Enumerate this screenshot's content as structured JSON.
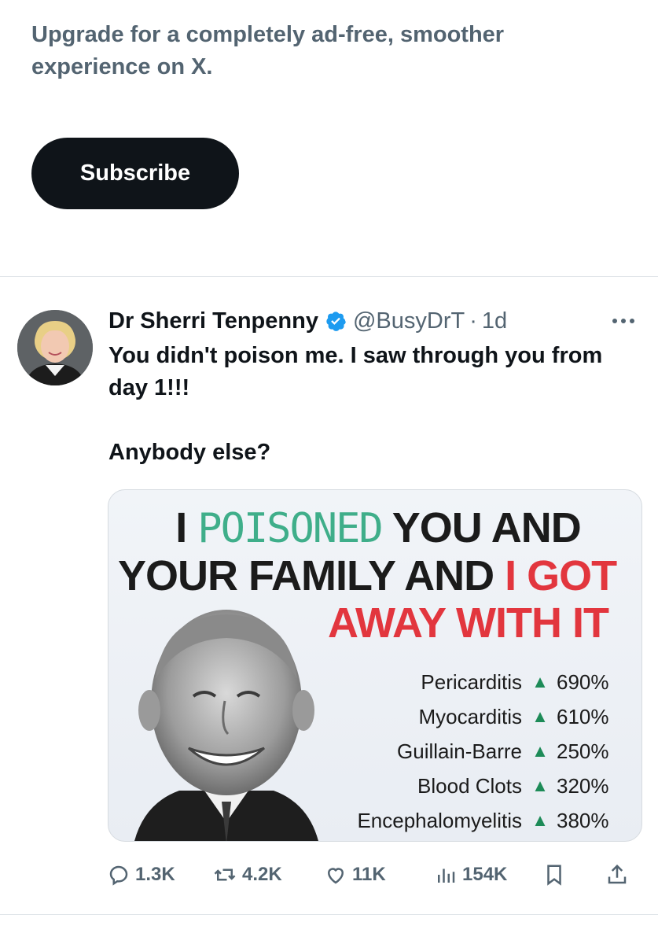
{
  "promo": {
    "text": "Upgrade for a completely ad-free, smoother experience on X.",
    "subscribe_label": "Subscribe"
  },
  "tweet": {
    "author": {
      "display_name": "Dr Sherri Tenpenny",
      "handle": "@BusyDrT",
      "separator": "·",
      "time": "1d",
      "verified": true
    },
    "text_lines": [
      "You didn't poison me. I saw through you from day 1!!!",
      "Anybody else?"
    ],
    "media": {
      "headline": {
        "i": "I",
        "poisoned": "POISONED",
        "you_and": "YOU AND",
        "your_family_and": "YOUR FAMILY AND",
        "i_got": "I GOT",
        "away_with_it": "AWAY WITH IT"
      },
      "stats": [
        {
          "name": "Pericarditis",
          "value": "690%"
        },
        {
          "name": "Myocarditis",
          "value": "610%"
        },
        {
          "name": "Guillain-Barre",
          "value": "250%"
        },
        {
          "name": "Blood Clots",
          "value": "320%"
        },
        {
          "name": "Encephalomyelitis",
          "value": "380%"
        }
      ],
      "colors": {
        "green": "#3fae8a",
        "red": "#e2363e",
        "arrow": "#1d8b58"
      }
    },
    "actions": {
      "replies": "1.3K",
      "reposts": "4.2K",
      "likes": "11K",
      "views": "154K"
    }
  },
  "icons": {
    "verified": "verified-badge-icon",
    "more": "more-horizontal-icon",
    "reply": "reply-icon",
    "repost": "repost-icon",
    "like": "heart-icon",
    "views": "views-chart-icon",
    "bookmark": "bookmark-icon",
    "share": "share-icon"
  },
  "colors": {
    "text_primary": "#0f1419",
    "text_secondary": "#536471",
    "verified_blue": "#1d9bf0",
    "button_dark": "#0f1419"
  }
}
